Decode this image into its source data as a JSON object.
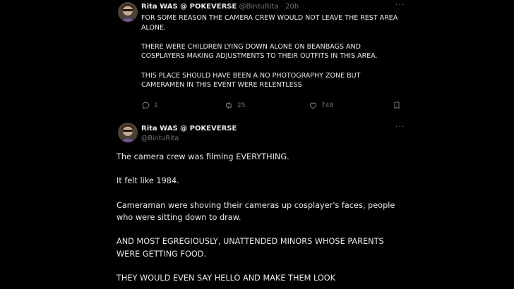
{
  "tweet1": {
    "author_name": "Rita WAS @ POKEVERSE",
    "author_handle": "@BintuRita",
    "separator": "·",
    "time": "20h",
    "more_label": "···",
    "paragraphs": [
      "FOR SOME REASON THE CAMERA CREW WOULD NOT LEAVE THE REST AREA ALONE.",
      "THERE WERE CHILDREN LYING DOWN ALONE ON BEANBAGS AND COSPLAYERS MAKING ADJUSTMENTS TO THEIR OUTFITS IN THIS AREA.",
      "THIS PLACE SHOULD HAVE BEEN A NO PHOTOGRAPHY ZONE BUT CAMERAMEN IN THIS EVENT WERE RELENTLESS"
    ],
    "actions": {
      "reply_count": "1",
      "retweet_count": "25",
      "like_count": "748"
    },
    "icons": {
      "reply": "reply-icon",
      "retweet": "retweet-icon",
      "like": "heart-icon",
      "bookmark": "bookmark-icon"
    }
  },
  "tweet2": {
    "author_name": "Rita WAS @ POKEVERSE",
    "author_handle": "@BintuRita",
    "more_label": "···",
    "paragraphs": [
      "The camera crew was filming EVERYTHING.",
      "It felt like 1984.",
      "Cameraman were shoving their cameras up cosplayer's faces, people who were sitting down to draw.",
      "AND MOST EGREGIOUSLY, UNATTENDED MINORS WHOSE PARENTS WERE GETTING FOOD.",
      "THEY WOULD EVEN SAY HELLO AND MAKE THEM LOOK"
    ]
  },
  "colors": {
    "background": "#000000",
    "text_primary": "#e7e9ea",
    "text_secondary": "#71767b"
  }
}
